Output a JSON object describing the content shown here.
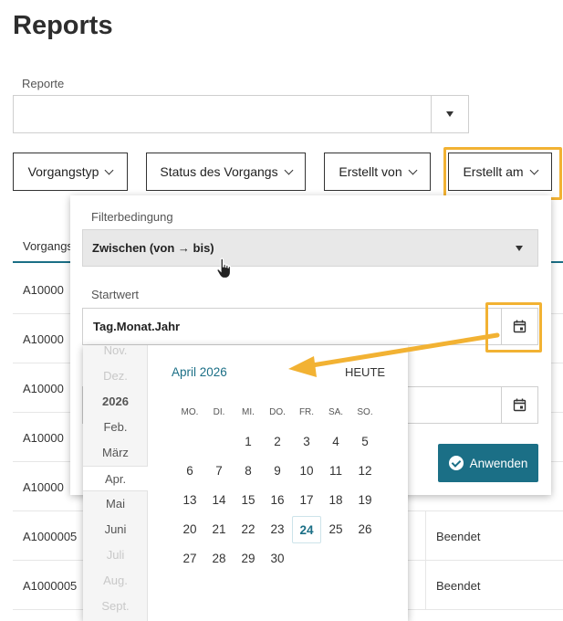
{
  "page": {
    "title": "Reports"
  },
  "report_select": {
    "label": "Reporte",
    "value": ""
  },
  "filters": [
    {
      "label": "Vorgangstyp"
    },
    {
      "label": "Status des Vorgangs"
    },
    {
      "label": "Erstellt von"
    },
    {
      "label": "Erstellt am"
    }
  ],
  "table": {
    "header": "Vorgangs",
    "rows": [
      {
        "id": "A10000",
        "status": ""
      },
      {
        "id": "A10000",
        "status": ""
      },
      {
        "id": "A10000",
        "status": ""
      },
      {
        "id": "A10000",
        "status": ""
      },
      {
        "id": "A10000",
        "status": ""
      },
      {
        "id": "A1000005",
        "status": "Beendet"
      },
      {
        "id": "A1000005",
        "status": "Beendet"
      }
    ]
  },
  "popup": {
    "condition_label": "Filterbedingung",
    "condition_value": "Zwischen (von → bis)",
    "start_label": "Startwert",
    "start_placeholder": "Tag.Monat.Jahr",
    "apply_label": "Anwenden"
  },
  "datepicker": {
    "month_title": "April 2026",
    "today_label": "HEUTE",
    "month_list": [
      "Nov.",
      "Dez.",
      "2026",
      "Feb.",
      "März",
      "Apr.",
      "Mai",
      "Juni",
      "Juli",
      "Aug.",
      "Sept."
    ],
    "selected_month": "Apr.",
    "weekdays": [
      "MO.",
      "DI.",
      "MI.",
      "DO.",
      "FR.",
      "SA.",
      "SO."
    ],
    "weeks": [
      [
        "",
        "",
        "1",
        "2",
        "3",
        "4",
        "5"
      ],
      [
        "6",
        "7",
        "8",
        "9",
        "10",
        "11",
        "12"
      ],
      [
        "13",
        "14",
        "15",
        "16",
        "17",
        "18",
        "19"
      ],
      [
        "20",
        "21",
        "22",
        "23",
        "24",
        "25",
        "26"
      ],
      [
        "27",
        "28",
        "29",
        "30",
        "",
        "",
        ""
      ]
    ],
    "today": "24"
  },
  "colors": {
    "accent": "#1b6f86",
    "highlight": "#f2b233"
  }
}
